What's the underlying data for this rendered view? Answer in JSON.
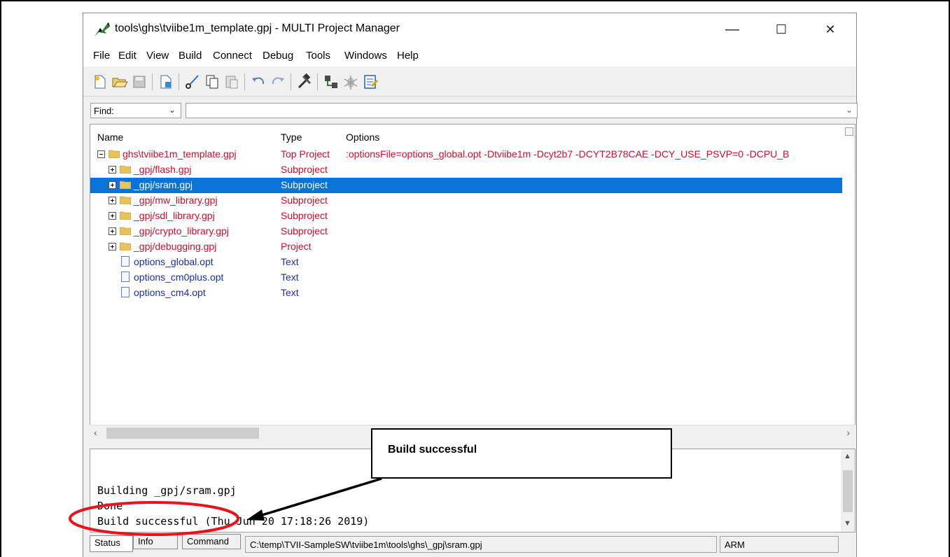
{
  "window": {
    "title": "tools\\ghs\\tviibe1m_template.gpj - MULTI Project Manager",
    "minimize": "—",
    "maximize": "☐",
    "close": "✕"
  },
  "menu": [
    "File",
    "Edit",
    "View",
    "Build",
    "Connect",
    "Debug",
    "Tools",
    "Windows",
    "Help"
  ],
  "find": {
    "label": "Find:",
    "value": ""
  },
  "tree": {
    "columns": {
      "name": "Name",
      "type": "Type",
      "options": "Options"
    },
    "rows": [
      {
        "name": "ghs\\tviibe1m_template.gpj",
        "type": "Top Project",
        "options": ":optionsFile=options_global.opt -Dtviibe1m -Dcyt2b7 -DCYT2B78CAE -DCY_USE_PSVP=0 -DCPU_B"
      },
      {
        "name": "_gpj/flash.gpj",
        "type": "Subproject",
        "options": ""
      },
      {
        "name": "_gpj/sram.gpj",
        "type": "Subproject",
        "options": ""
      },
      {
        "name": "_gpj/mw_library.gpj",
        "type": "Subproject",
        "options": ""
      },
      {
        "name": "_gpj/sdl_library.gpj",
        "type": "Subproject",
        "options": ""
      },
      {
        "name": "_gpj/crypto_library.gpj",
        "type": "Subproject",
        "options": ""
      },
      {
        "name": "_gpj/debugging.gpj",
        "type": "Project",
        "options": ""
      },
      {
        "name": "options_global.opt",
        "type": "Text",
        "options": ""
      },
      {
        "name": "options_cm0plus.opt",
        "type": "Text",
        "options": ""
      },
      {
        "name": "options_cm4.opt",
        "type": "Text",
        "options": ""
      }
    ]
  },
  "output": {
    "lines": [
      "Building _gpj/sram.gpj",
      "Done",
      "Build successful (Thu Jun 20 17:18:26 2019)"
    ]
  },
  "status": {
    "tabs": [
      "Status",
      "Info",
      "Command"
    ],
    "path": "C:\\temp\\TVII-SampleSW\\tviibe1m\\tools\\ghs\\_gpj\\sram.gpj",
    "arch": "ARM"
  },
  "callout": {
    "text": "Build successful"
  },
  "colors": {
    "selected": "#0a74d6",
    "project_text": "#c8102e",
    "file_text": "#1b2fa3",
    "annotation": "#e8141d"
  }
}
